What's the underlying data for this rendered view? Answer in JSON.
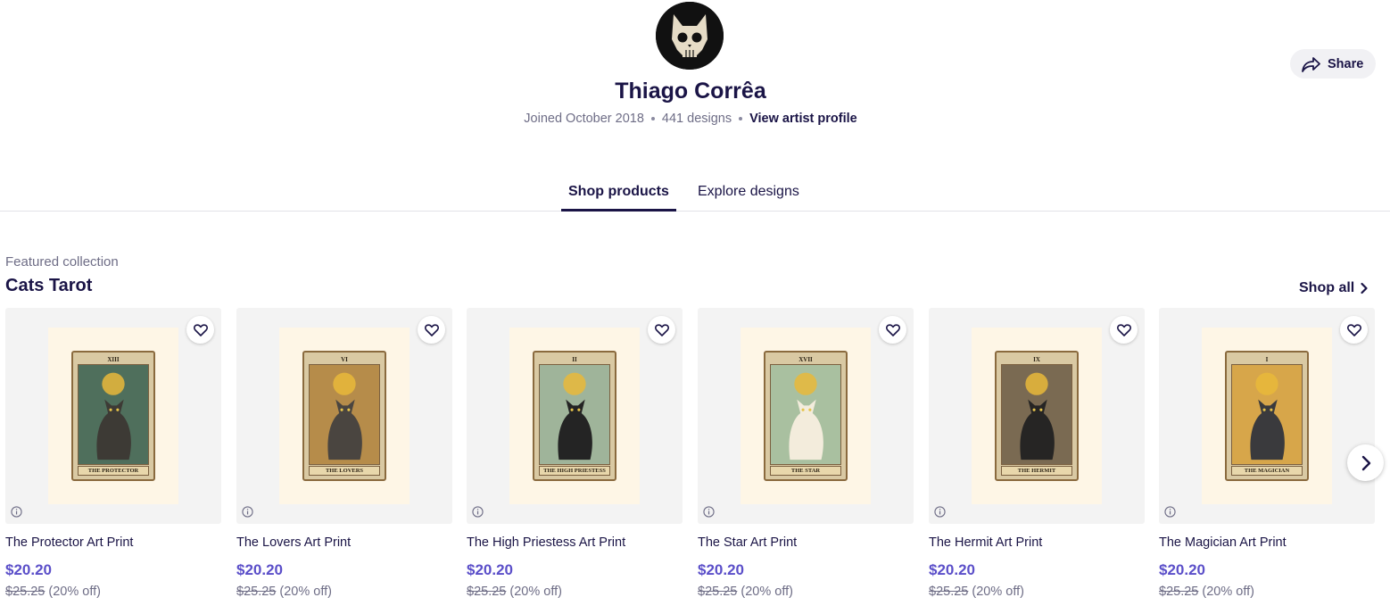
{
  "artist": {
    "name": "Thiago Corrêa",
    "joined": "Joined October 2018",
    "designs_count": "441 designs",
    "profile_link": "View artist profile"
  },
  "share": {
    "label": "Share"
  },
  "tabs": [
    {
      "label": "Shop products",
      "active": true
    },
    {
      "label": "Explore designs",
      "active": false
    }
  ],
  "collection": {
    "kicker": "Featured collection",
    "title": "Cats Tarot",
    "shop_all": "Shop all"
  },
  "products": [
    {
      "title": "The Protector Art Print",
      "price": "$20.20",
      "original_price": "$25.25",
      "discount": "(20% off)",
      "card_number": "XIII",
      "card_caption": "THE PROTECTOR",
      "scene_color": "#4f6f5c",
      "cat_color": "#3d3a35"
    },
    {
      "title": "The Lovers Art Print",
      "price": "$20.20",
      "original_price": "$25.25",
      "discount": "(20% off)",
      "card_number": "VI",
      "card_caption": "THE LOVERS",
      "scene_color": "#b68c4a",
      "cat_color": "#4a4540"
    },
    {
      "title": "The High Priestess Art Print",
      "price": "$20.20",
      "original_price": "$25.25",
      "discount": "(20% off)",
      "card_number": "II",
      "card_caption": "THE HIGH PRIESTESS",
      "scene_color": "#9fb49a",
      "cat_color": "#242424"
    },
    {
      "title": "The Star Art Print",
      "price": "$20.20",
      "original_price": "$25.25",
      "discount": "(20% off)",
      "card_number": "XVII",
      "card_caption": "THE STAR",
      "scene_color": "#a9c0a0",
      "cat_color": "#f3ecdc"
    },
    {
      "title": "The Hermit Art Print",
      "price": "$20.20",
      "original_price": "$25.25",
      "discount": "(20% off)",
      "card_number": "IX",
      "card_caption": "THE HERMIT",
      "scene_color": "#7a6a52",
      "cat_color": "#262524"
    },
    {
      "title": "The Magician Art Print",
      "price": "$20.20",
      "original_price": "$25.25",
      "discount": "(20% off)",
      "card_number": "I",
      "card_caption": "THE MAGICIAN",
      "scene_color": "#d7a64a",
      "cat_color": "#3a3a3d"
    }
  ],
  "colors": {
    "text": "#1a1446",
    "price": "#5b4fc9",
    "muted": "#6e6d86"
  },
  "icons": [
    "share-arrow-icon",
    "chevron-right-icon",
    "heart-icon",
    "info-icon",
    "next-arrow-icon",
    "skull-cat-logo"
  ]
}
